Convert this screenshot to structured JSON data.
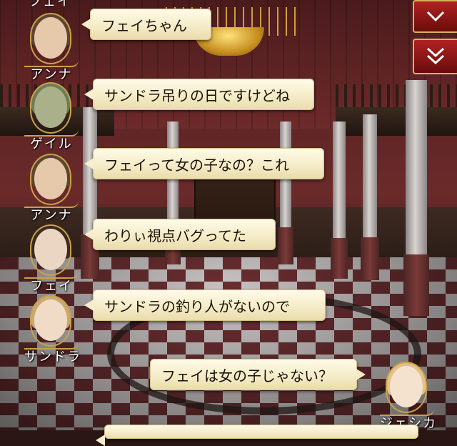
{
  "controls": {
    "scroll_down_icon": "chevron-down-icon",
    "fast_forward_icon": "double-chevron-down-icon"
  },
  "top_cut_name": "フェイ",
  "messages": [
    {
      "speaker": "アンナ",
      "text": "フェイちゃん",
      "side": "left"
    },
    {
      "speaker": "ゲイル",
      "text": "サンドラ吊りの日ですけどね",
      "side": "left"
    },
    {
      "speaker": "アンナ",
      "text": "フェイって女の子なの？これ",
      "side": "left"
    },
    {
      "speaker": "フェイ",
      "text": "わりぃ視点バグってた",
      "side": "left"
    },
    {
      "speaker": "サンドラ",
      "text": "サンドラの釣り人がないので",
      "side": "left"
    },
    {
      "speaker": "ジェシカ",
      "text": "フェイは女の子じゃない？",
      "side": "right"
    }
  ],
  "colors": {
    "accent_red": "#a31d1d",
    "gold_trim": "#c9a24a",
    "bubble_bg": "#f6eecc"
  }
}
